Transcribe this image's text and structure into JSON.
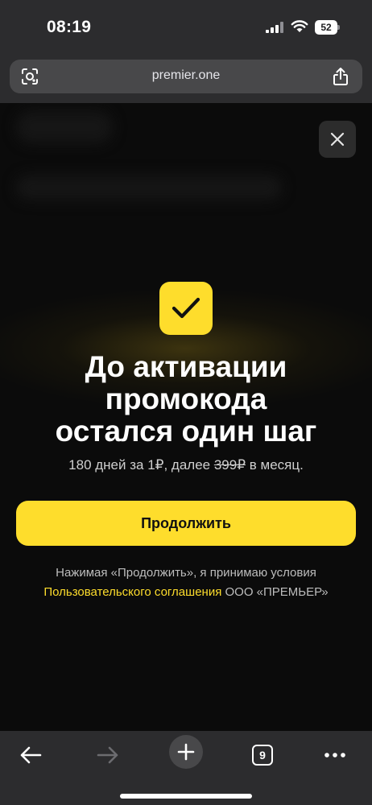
{
  "status_bar": {
    "time": "08:19",
    "battery": "52"
  },
  "browser": {
    "url": "premier.one",
    "tabs_count": "9"
  },
  "modal": {
    "headline": [
      "До активации",
      "промокода",
      "остался один шаг"
    ],
    "subtitle": {
      "prefix": "180 дней за 1₽, далее ",
      "old_price": "399₽",
      "suffix": " в месяц."
    },
    "continue_label": "Продолжить",
    "terms": {
      "line1": "Нажимая «Продолжить», я принимаю условия",
      "link": "Пользовательского соглашения",
      "line2_suffix": " ООО «ПРЕМЬЕР»"
    }
  },
  "colors": {
    "accent": "#fedd2c",
    "background": "#0b0b0b",
    "chrome": "#2c2c2e"
  },
  "icons": [
    "signal-icon",
    "wifi-icon",
    "battery-icon",
    "lens-icon",
    "share-icon",
    "close-icon",
    "checkmark-icon",
    "back-arrow-icon",
    "forward-arrow-icon",
    "plus-icon",
    "more-icon"
  ]
}
